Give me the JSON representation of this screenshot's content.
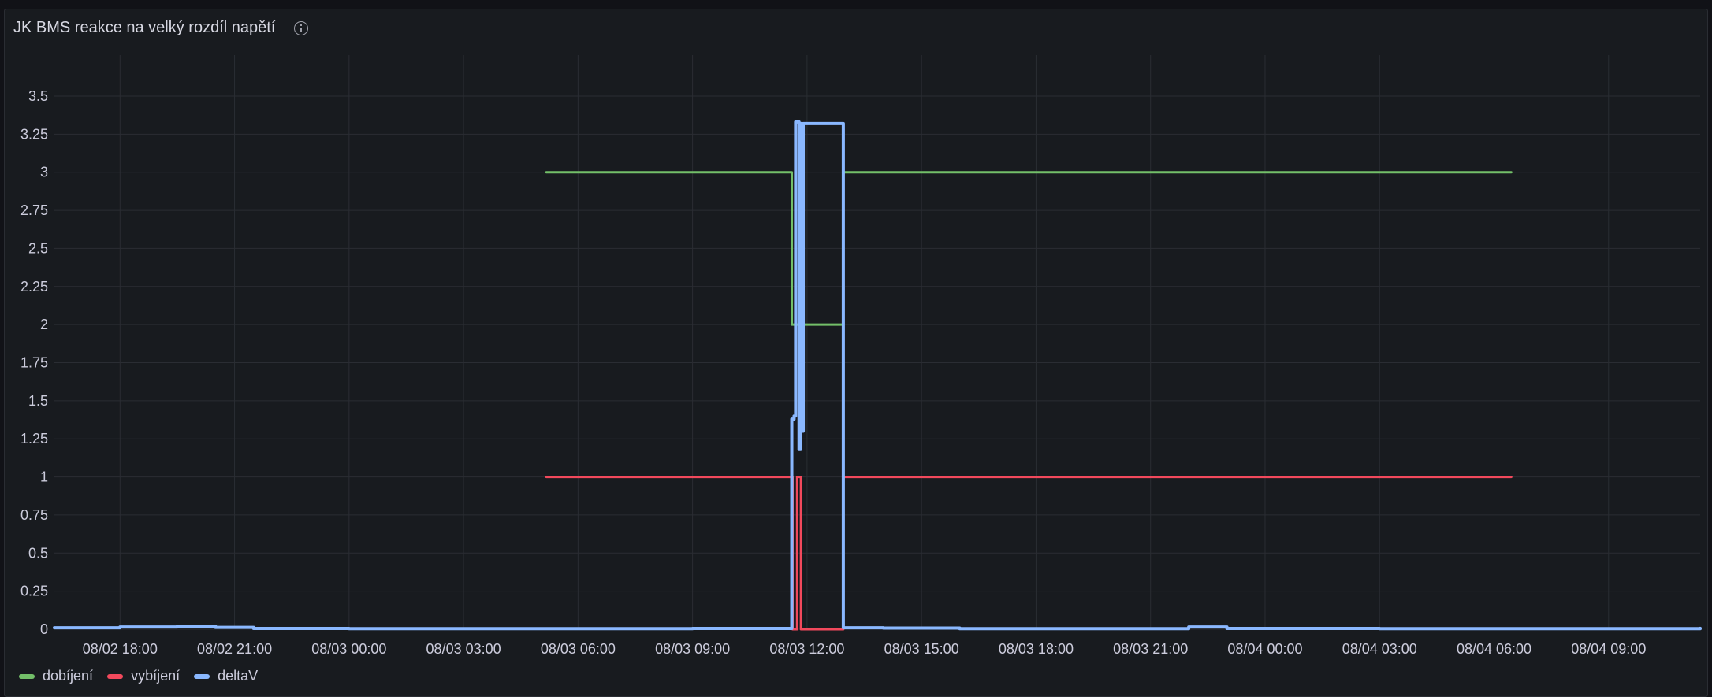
{
  "panel": {
    "title": "JK BMS reakce na velký rozdíl napětí",
    "info_icon": "info-circle-icon"
  },
  "chart_data": {
    "type": "line",
    "title": "JK BMS reakce na velký rozdíl napětí",
    "xlabel": "",
    "ylabel": "",
    "x_unit": "hours since 08/02 18:00",
    "xlim": [
      -1.72,
      41.4
    ],
    "ylim": [
      0,
      3.5
    ],
    "grid": true,
    "legend_position": "bottom-left",
    "y_ticks": [
      "0",
      "0.25",
      "0.5",
      "0.75",
      "1",
      "1.25",
      "1.5",
      "1.75",
      "2",
      "2.25",
      "2.5",
      "2.75",
      "3",
      "3.25",
      "3.5"
    ],
    "x_ticks": [
      {
        "h": 0,
        "label": "08/02 18:00"
      },
      {
        "h": 3,
        "label": "08/02 21:00"
      },
      {
        "h": 6,
        "label": "08/03 00:00"
      },
      {
        "h": 9,
        "label": "08/03 03:00"
      },
      {
        "h": 12,
        "label": "08/03 06:00"
      },
      {
        "h": 15,
        "label": "08/03 09:00"
      },
      {
        "h": 18,
        "label": "08/03 12:00"
      },
      {
        "h": 21,
        "label": "08/03 15:00"
      },
      {
        "h": 24,
        "label": "08/03 18:00"
      },
      {
        "h": 27,
        "label": "08/03 21:00"
      },
      {
        "h": 30,
        "label": "08/04 00:00"
      },
      {
        "h": 33,
        "label": "08/04 03:00"
      },
      {
        "h": 36,
        "label": "08/04 06:00"
      },
      {
        "h": 39,
        "label": "08/04 09:00"
      }
    ],
    "series": [
      {
        "name": "dobíjení",
        "color": "#73bf69",
        "width": 3,
        "points": [
          [
            11.17,
            3
          ],
          [
            17.6,
            2
          ],
          [
            18.95,
            3
          ],
          [
            36.45,
            3
          ]
        ]
      },
      {
        "name": "vybíjení",
        "color": "#f2495c",
        "width": 3,
        "points": [
          [
            11.17,
            1
          ],
          [
            17.62,
            0
          ],
          [
            17.74,
            1
          ],
          [
            17.84,
            0
          ],
          [
            18.95,
            1
          ],
          [
            36.45,
            1
          ]
        ]
      },
      {
        "name": "deltaV",
        "color": "#8ab8ff",
        "width": 4,
        "points": [
          [
            -1.72,
            0.01
          ],
          [
            0,
            0.015
          ],
          [
            1.5,
            0.02
          ],
          [
            2.5,
            0.012
          ],
          [
            3.5,
            0.005
          ],
          [
            6,
            0.004
          ],
          [
            9,
            0.004
          ],
          [
            12,
            0.004
          ],
          [
            15,
            0.005
          ],
          [
            17.58,
            0.005
          ],
          [
            17.6,
            1.38
          ],
          [
            17.66,
            1.4
          ],
          [
            17.7,
            3.33
          ],
          [
            17.76,
            3.33
          ],
          [
            17.79,
            1.18
          ],
          [
            17.83,
            3.32
          ],
          [
            17.87,
            1.3
          ],
          [
            17.9,
            3.32
          ],
          [
            18.5,
            3.32
          ],
          [
            18.92,
            3.32
          ],
          [
            18.95,
            0.01
          ],
          [
            20,
            0.008
          ],
          [
            22,
            0.004
          ],
          [
            27,
            0.004
          ],
          [
            28,
            0.015
          ],
          [
            29,
            0.005
          ],
          [
            33,
            0.004
          ],
          [
            36,
            0.004
          ],
          [
            41.4,
            0.006
          ]
        ]
      }
    ]
  }
}
